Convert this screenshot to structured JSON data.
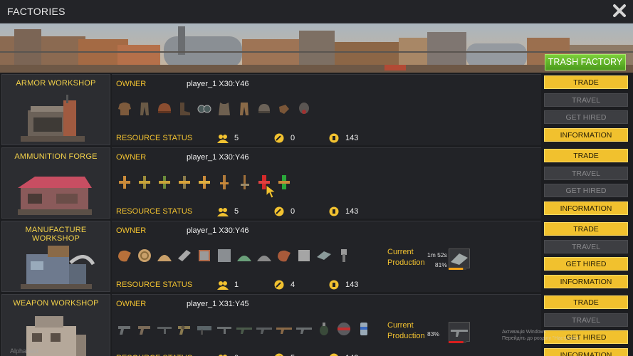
{
  "window": {
    "title": "FACTORIES"
  },
  "trash_button": "TRASH FACTORY",
  "labels": {
    "owner": "OWNER",
    "resource_status": "RESOURCE STATUS",
    "current_production": "Current Production"
  },
  "buttons": {
    "trade": "TRADE",
    "travel": "TRAVEL",
    "get_hired": "GET HIRED",
    "information": "INFORMATION"
  },
  "colors": {
    "accent": "#f2c230",
    "button_active": "#f1c12e",
    "button_disabled": "#3d3e42",
    "trash": "#5bb02a"
  },
  "factories": [
    {
      "name": "ARMOR WORKSHOP",
      "owner": "player_1  X30:Y46",
      "resources": {
        "workers": "5",
        "repair": "0",
        "coins": "143"
      },
      "items": [
        "jacket-icon",
        "pants-icon",
        "helmet-icon",
        "boots-icon",
        "goggles-icon",
        "vest-icon",
        "trousers-icon",
        "cap-icon",
        "gloves-icon",
        "gasmask-icon"
      ],
      "get_hired_enabled": false,
      "production": null
    },
    {
      "name": "AMMUNITION FORGE",
      "owner": "player_1  X30:Y46",
      "resources": {
        "workers": "5",
        "repair": "0",
        "coins": "143"
      },
      "items": [
        "bullet-icon",
        "bullet-icon",
        "bullet-icon",
        "bullet-icon",
        "bullet-icon",
        "bullet-icon",
        "bullet-icon",
        "shell-red-icon",
        "shell-green-icon"
      ],
      "get_hired_enabled": false,
      "production": null
    },
    {
      "name": "MANUFACTURE WORKSHOP",
      "owner": "player_1  X30:Y46",
      "resources": {
        "workers": "1",
        "repair": "4",
        "coins": "143"
      },
      "items": [
        "leather-roll-icon",
        "coil-icon",
        "sand-pile-icon",
        "metal-bar-icon",
        "steel-block-icon",
        "box-icon",
        "gem-pile-icon",
        "ore-pile-icon",
        "leather-roll-icon",
        "steel-block-icon",
        "plates-icon",
        "bolt-icon"
      ],
      "get_hired_enabled": true,
      "production": {
        "time": "1m 52s",
        "percent": "81%",
        "progress": 0.81,
        "bar_color": "#f2a21a"
      }
    },
    {
      "name": "WEAPON WORKSHOP",
      "owner": "player_1  X31:Y45",
      "resources": {
        "workers": "0",
        "repair": "5",
        "coins": "143"
      },
      "items": [
        "pistol-icon",
        "pistol-icon",
        "smg-icon",
        "revolver-icon",
        "launcher-icon",
        "smg-icon",
        "rifle-icon",
        "rifle-icon",
        "shotgun-icon",
        "rifle-icon",
        "grenade-icon",
        "mine-icon",
        "canister-icon"
      ],
      "get_hired_enabled": true,
      "production": {
        "time": "",
        "percent": "83%",
        "progress": 0.83,
        "bar_color": "#d81e1e"
      }
    }
  ],
  "overlay": {
    "activation_line1": "Активація Windows",
    "activation_line2": "Перейдіть до розділу \"Настройки\"",
    "alpha_text": "Alpha test"
  }
}
